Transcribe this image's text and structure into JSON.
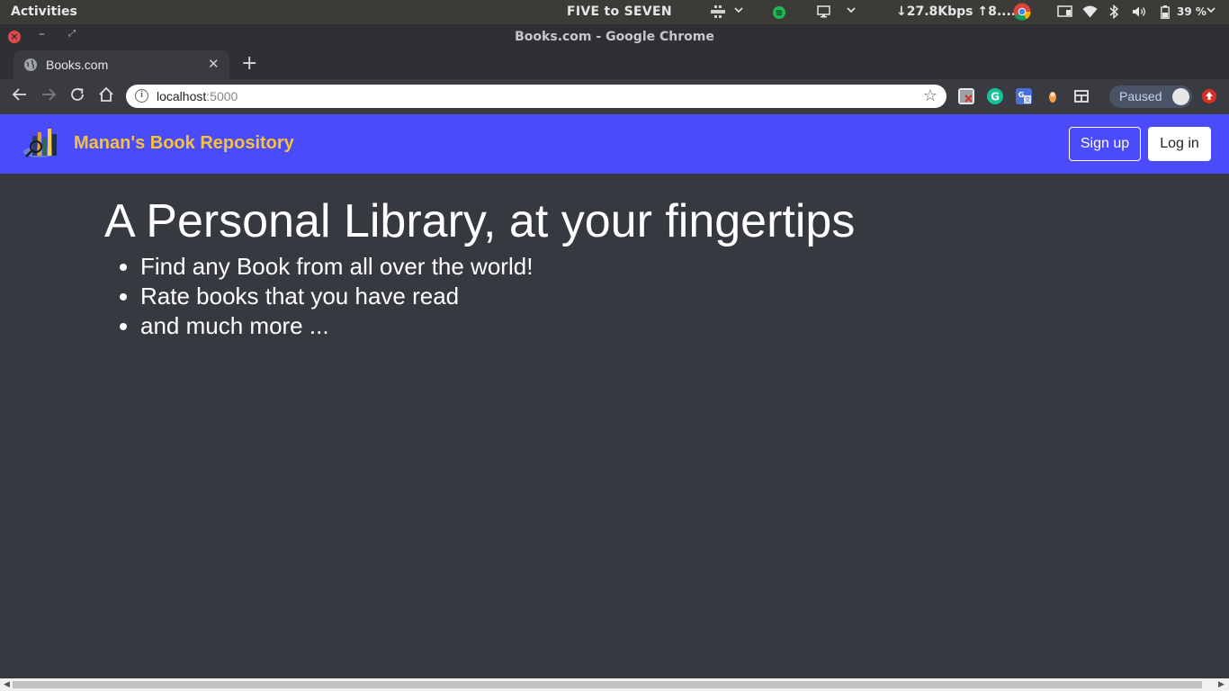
{
  "system_bar": {
    "activities": "Activities",
    "clock": "FIVE to SEVEN",
    "network_speed": "↓27.8Kbps ↑8....",
    "battery": "39 %",
    "icons": [
      "workspace-grid-icon",
      "dropdown-icon",
      "spotify-icon",
      "display-icon",
      "dropdown-icon",
      "chrome-icon",
      "cast-icon",
      "wifi-icon",
      "bluetooth-icon",
      "volume-icon",
      "battery-icon",
      "power-menu-icon"
    ]
  },
  "window": {
    "title": "Books.com - Google Chrome"
  },
  "browser": {
    "tab_title": "Books.com",
    "url_host": "localhost",
    "url_port": ":5000",
    "profile_status": "Paused",
    "extensions": [
      "extension-disabled-icon",
      "grammarly-icon",
      "google-translate-icon",
      "extension-orange-icon",
      "extension-grid-icon"
    ]
  },
  "navbar": {
    "brand": "Manan's Book Repository",
    "signup_label": "Sign up",
    "login_label": "Log in",
    "background_color": "#4a4cfb",
    "brand_color": "#f5c23c"
  },
  "hero": {
    "title": "A Personal Library, at your fingertips",
    "features": [
      "Find any Book from all over the world!",
      "Rate books that you have read",
      "and much more ..."
    ]
  }
}
